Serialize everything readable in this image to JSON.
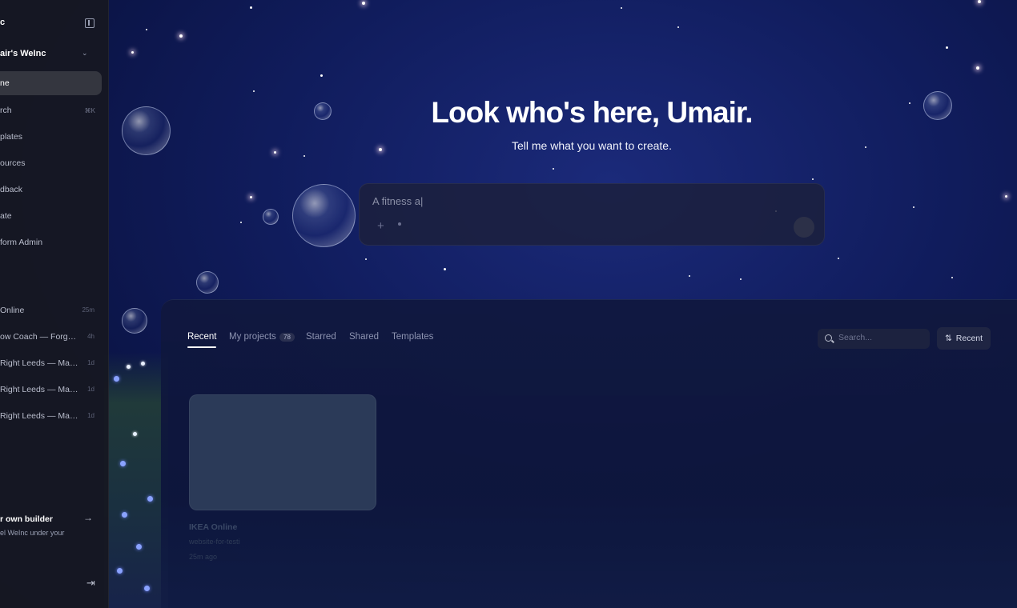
{
  "sidebar": {
    "app_title": "c",
    "workspace": "air's WeInc",
    "nav": [
      {
        "label": "ne",
        "kbd": ""
      },
      {
        "label": "rch",
        "kbd": "⌘K"
      },
      {
        "label": "plates",
        "kbd": ""
      },
      {
        "label": "ources",
        "kbd": ""
      },
      {
        "label": "dback",
        "kbd": ""
      },
      {
        "label": "ate",
        "kbd": ""
      },
      {
        "label": "form Admin",
        "kbd": ""
      }
    ],
    "recent": [
      {
        "label": "Online",
        "time": "25m"
      },
      {
        "label": "ow Coach — Forge ...",
        "time": "4h"
      },
      {
        "label": "Right Leeds — Marr...",
        "time": "1d"
      },
      {
        "label": "Right Leeds — Marr...",
        "time": "1d"
      },
      {
        "label": "Right Leeds — Marr...",
        "time": "1d"
      }
    ],
    "builder": {
      "title": "r own builder",
      "subtitle": "el WeInc under your"
    }
  },
  "hero": {
    "title": "Look who's here, Umair.",
    "subtitle": "Tell me what you want to create.",
    "prompt_value": "A fitness a|"
  },
  "projects": {
    "tabs": [
      {
        "label": "Recent",
        "active": true
      },
      {
        "label": "My projects",
        "badge": "78"
      },
      {
        "label": "Starred"
      },
      {
        "label": "Shared"
      },
      {
        "label": "Templates"
      }
    ],
    "search_placeholder": "Search...",
    "sort_label": "Recent",
    "cards": [
      {
        "title": "IKEA Online",
        "subtitle": "website-for-testi",
        "time": "25m ago"
      }
    ]
  },
  "colors": {
    "sidebar_bg": "#16181f",
    "panel_bg": "#101a3e",
    "accent_text": "#ffffff"
  }
}
